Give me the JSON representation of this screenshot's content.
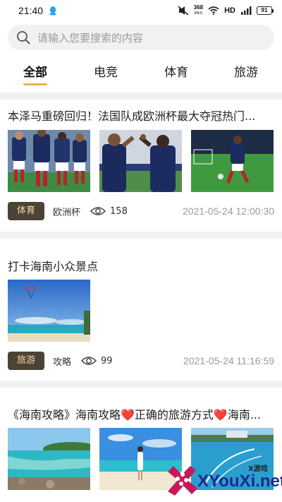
{
  "status_bar": {
    "time": "21:40",
    "net_speed_value": "368",
    "net_speed_unit": "KB/S",
    "hd_label": "HD",
    "battery_level": "91"
  },
  "search": {
    "placeholder": "请输入您要搜索的内容"
  },
  "tabs": [
    {
      "label": "全部",
      "active": true
    },
    {
      "label": "电竞",
      "active": false
    },
    {
      "label": "体育",
      "active": false
    },
    {
      "label": "旅游",
      "active": false
    }
  ],
  "articles": [
    {
      "title": "本泽马重磅回归！法国队成欧洲杯最大夺冠热门...",
      "tag": "体育",
      "sub_label": "欧洲杯",
      "views": "158",
      "timestamp": "2021-05-24 12:00:30",
      "thumbnails": [
        "football-team-photo",
        "football-celebration-photo",
        "football-player-photo"
      ]
    },
    {
      "title": "打卡海南小众景点",
      "tag": "旅游",
      "sub_label": "攻略",
      "views": "99",
      "timestamp": "2021-05-24 11:16:59",
      "thumbnails": [
        "beach-parasail-photo"
      ]
    },
    {
      "title": "《海南攻略》海南攻略❤️正确的旅游方式❤️海南...",
      "thumbnails": [
        "tropical-bay-photo",
        "beach-woman-photo",
        "coastal-resort-photo"
      ]
    }
  ],
  "watermark": {
    "text": "XYouXi.net",
    "small": "X游戏"
  },
  "colors": {
    "accent": "#e6b451",
    "tag_bg": "#4b4336",
    "tag_text": "#f3d9a4",
    "divider": "#f2f2f2"
  }
}
